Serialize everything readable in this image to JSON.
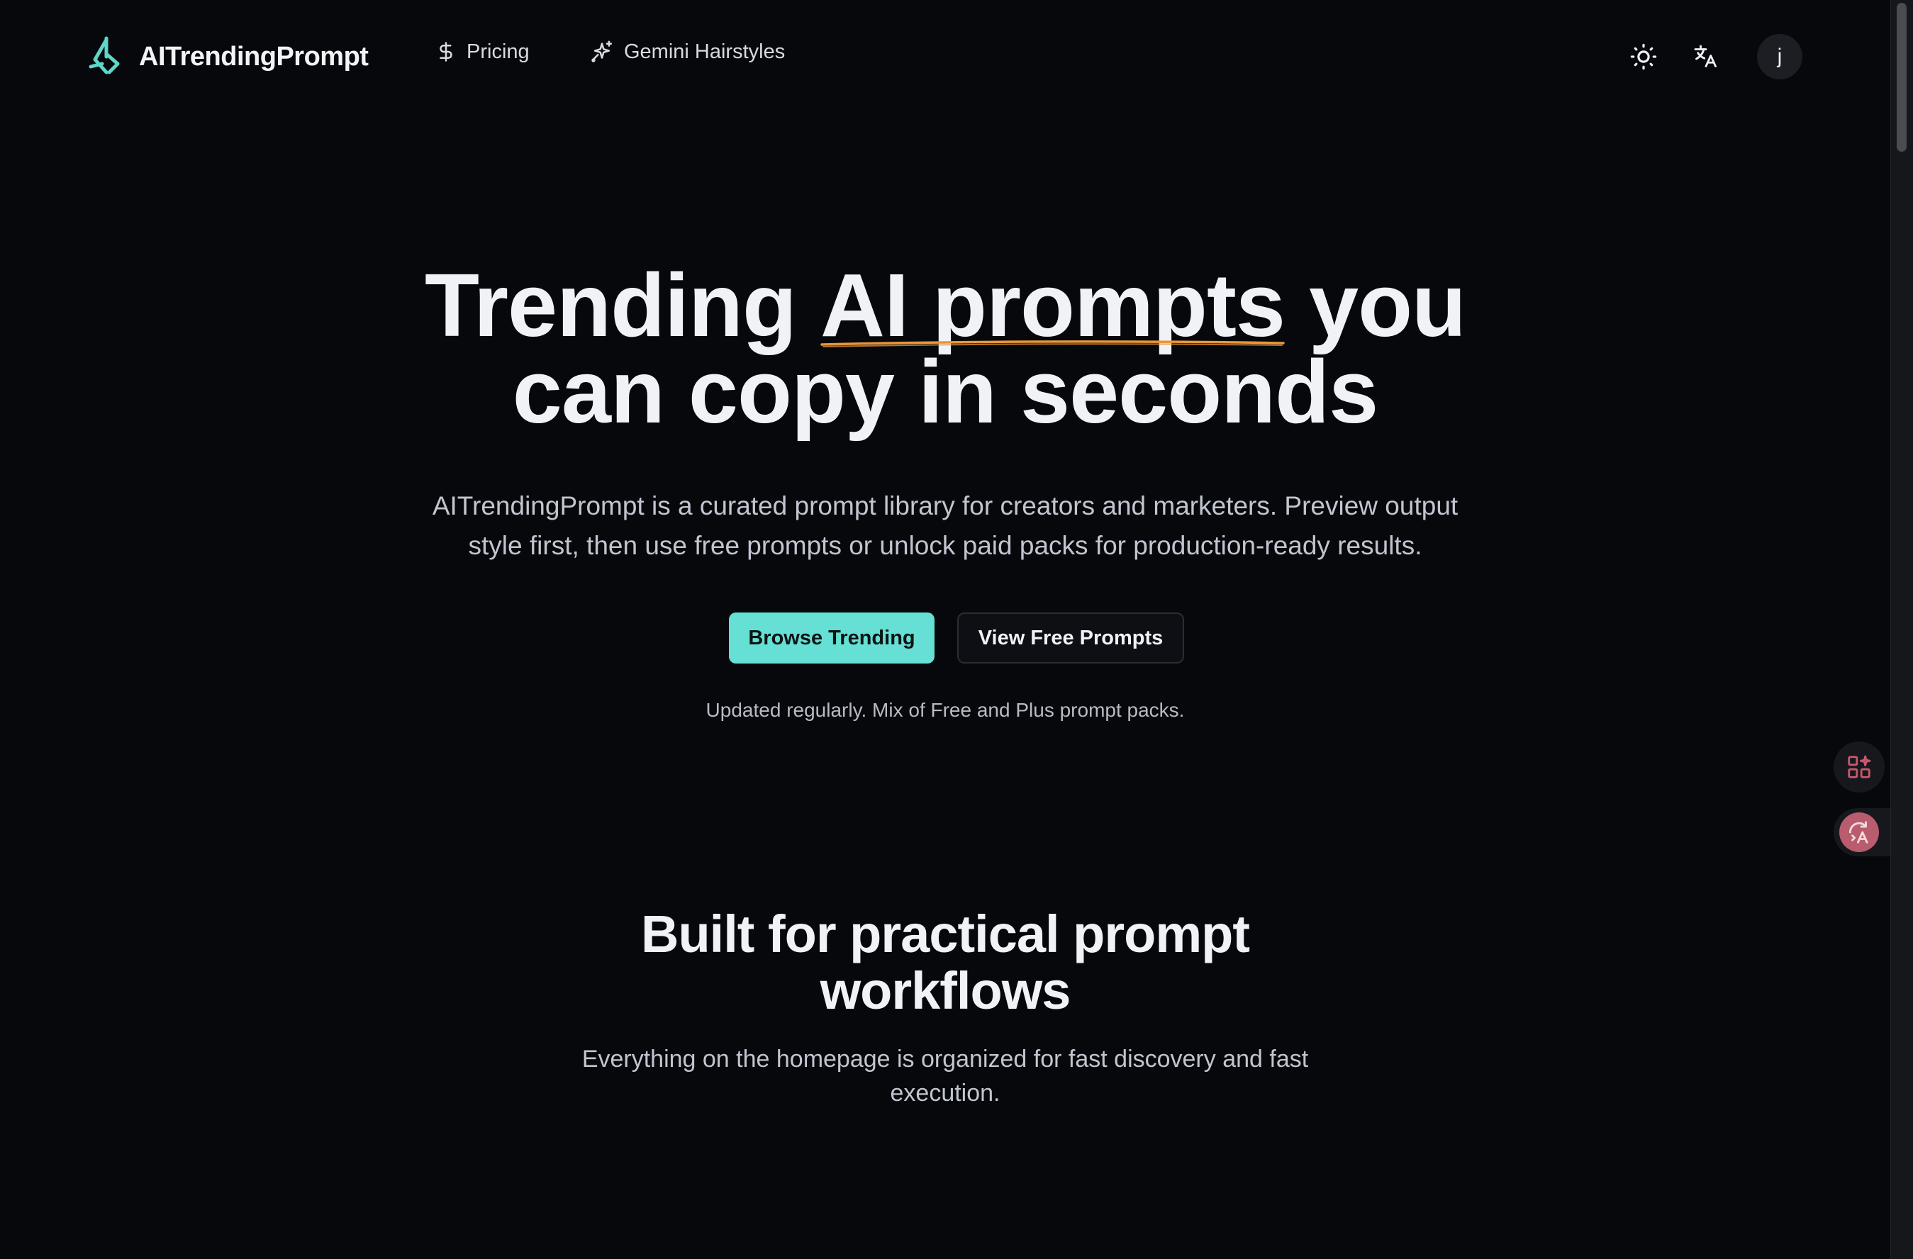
{
  "header": {
    "brand_name": "AITrendingPrompt",
    "nav": {
      "pricing_label": "Pricing",
      "gemini_label": "Gemini Hairstyles"
    },
    "avatar_initial": "j"
  },
  "hero": {
    "title_before": "Trending ",
    "title_highlight": "AI prompts",
    "title_after_line1": " you",
    "title_line2": "can copy in seconds",
    "subtitle_line1": "AITrendingPrompt is a curated prompt library for creators and marketers. Preview output",
    "subtitle_line2": "style first, then use free prompts or unlock paid packs for production-ready results.",
    "cta_primary": "Browse Trending",
    "cta_secondary": "View Free Prompts",
    "note": "Updated regularly. Mix of Free and Plus prompt packs."
  },
  "features": {
    "title_line1": "Built for practical prompt",
    "title_line2": "workflows",
    "subtitle_line1": "Everything on the homepage is organized for fast discovery and fast",
    "subtitle_line2": "execution."
  },
  "icons": {
    "logo": "brand-logo-icon",
    "pricing": "dollar-icon",
    "gemini": "sparkles-icon",
    "theme": "sun-icon",
    "language": "translate-icon",
    "side_1": "apps-sparkle-icon",
    "side_2": "translate-bubble-icon"
  },
  "colors": {
    "background": "#07080c",
    "accent": "#66dfd4",
    "highlight_underline": "#e8963a",
    "text_primary": "#f1f2f7",
    "text_secondary": "#c1c5cf",
    "side_widget_accent": "#b85c6e"
  }
}
